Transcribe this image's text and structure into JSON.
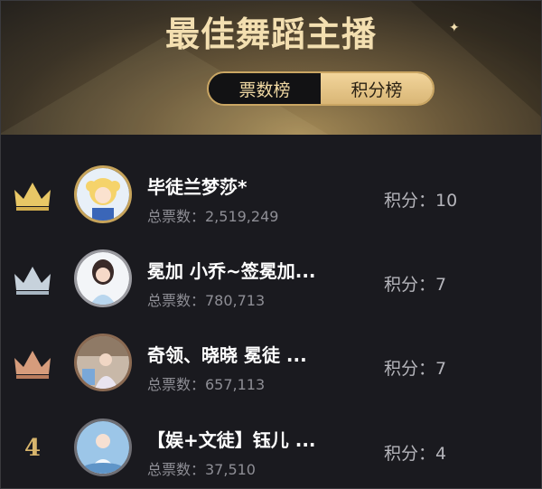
{
  "header": {
    "title": "最佳舞蹈主播",
    "tabs": [
      {
        "label": "票数榜",
        "active": true
      },
      {
        "label": "积分榜",
        "active": false
      }
    ]
  },
  "ranking": [
    {
      "rank": "1",
      "rank_icon": "crown-gold-icon",
      "name": "毕徒兰梦莎*",
      "votes": "总票数：2,519,249",
      "score": "积分：10"
    },
    {
      "rank": "2",
      "rank_icon": "crown-silver-icon",
      "name": "冕加 小乔~签冕加...",
      "votes": "总票数：780,713",
      "score": "积分：7"
    },
    {
      "rank": "3",
      "rank_icon": "crown-bronze-icon",
      "name": "奇领、晓晓 冕徒 ...",
      "votes": "总票数：657,113",
      "score": "积分：7"
    },
    {
      "rank": "4",
      "rank_icon": "",
      "name": "【娱+文徒】钰儿 ...",
      "votes": "总票数：37,510",
      "score": "积分：4"
    }
  ],
  "colors": {
    "gold": "#e8c766",
    "silver": "#c7d2dc",
    "bronze": "#d69c7c",
    "accent": "#caa663"
  }
}
